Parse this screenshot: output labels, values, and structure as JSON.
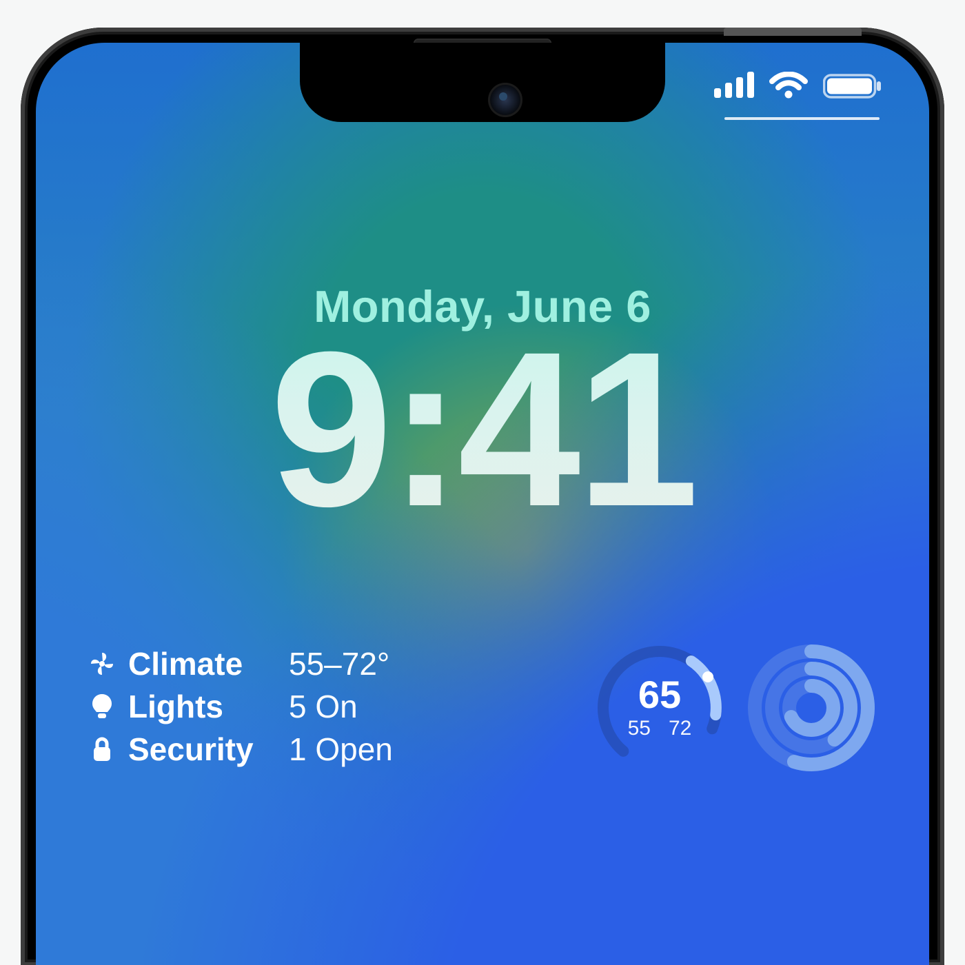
{
  "status": {
    "cellular_bars": 4,
    "wifi_strength": 3,
    "battery_percent": 100
  },
  "lock": {
    "date": "Monday, June 6",
    "time": "9:41"
  },
  "home_widget": {
    "rows": [
      {
        "icon": "fan-icon",
        "label": "Climate",
        "value": "55–72°"
      },
      {
        "icon": "bulb-icon",
        "label": "Lights",
        "value": "5 On"
      },
      {
        "icon": "lock-icon",
        "label": "Security",
        "value": "1 Open"
      }
    ]
  },
  "thermostat_widget": {
    "current": "65",
    "low": "55",
    "high": "72",
    "progress": 0.32
  },
  "activity_widget": {
    "rings": [
      {
        "name": "move",
        "progress": 0.55
      },
      {
        "name": "exercise",
        "progress": 0.4
      },
      {
        "name": "stand",
        "progress": 0.68
      }
    ]
  },
  "colors": {
    "date": "#9ff0e0",
    "ring_track": "rgba(255,255,255,0.22)",
    "ring_fill": "#85b4ff"
  }
}
